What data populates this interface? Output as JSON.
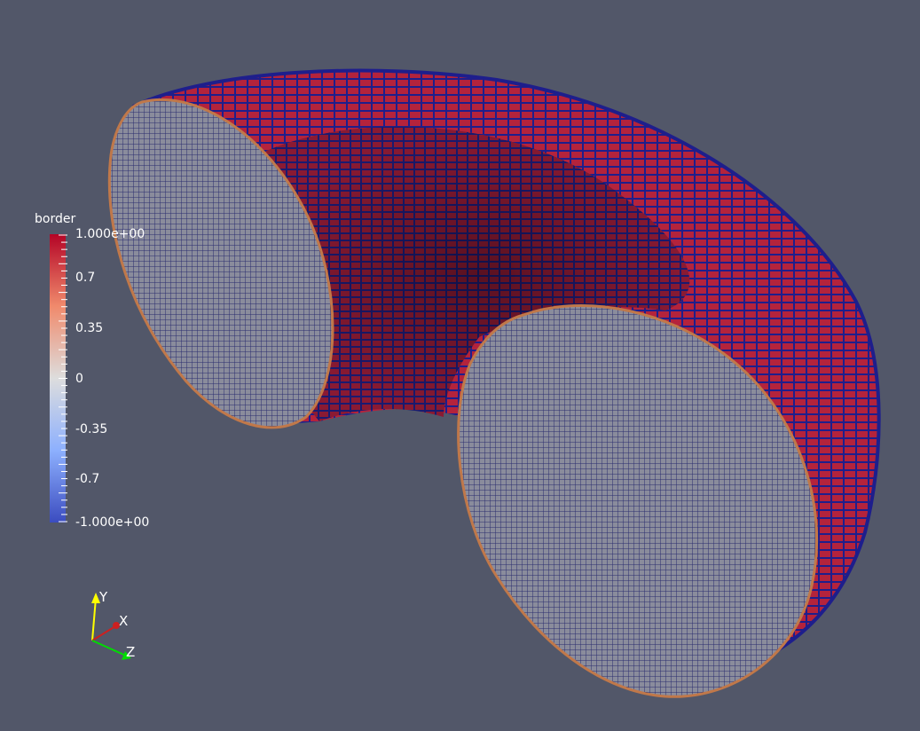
{
  "colors": {
    "background": "#525769",
    "surface_red": "#b4233c",
    "edge_blue": "#1e1e8c",
    "cap_grey": "#8a8c9c",
    "cap_grid": "#2a2d6e"
  },
  "colorbar": {
    "title": "border",
    "labels": [
      "1.000e+00",
      "0.7",
      "0.35",
      "0",
      "-0.35",
      "-0.7",
      "-1.000e+00"
    ],
    "range": [
      -1,
      1
    ],
    "colormap": "cool-to-warm"
  },
  "axes_triad": {
    "x_label": "X",
    "y_label": "Y",
    "z_label": "Z",
    "x_color": "#ff3030",
    "y_color": "#ffff00",
    "z_color": "#00dd00"
  }
}
